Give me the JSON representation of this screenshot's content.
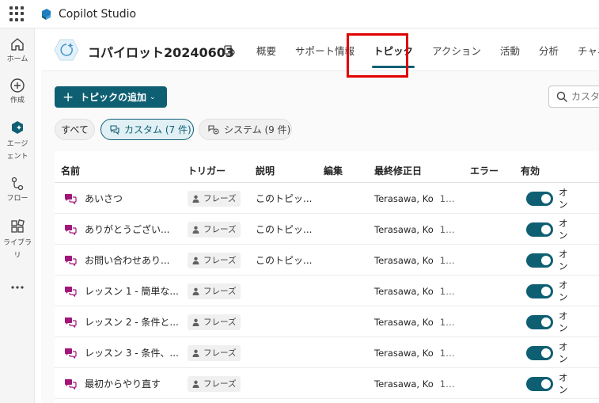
{
  "app": {
    "title": "Copilot Studio"
  },
  "colors": {
    "accent": "#0f5f73",
    "topic_icon": "#a1167a",
    "highlight": "#e00000"
  },
  "rail": {
    "items": [
      {
        "label": "ホーム",
        "icon": "home-icon"
      },
      {
        "label": "作成",
        "icon": "create-icon"
      },
      {
        "label": "エージェント",
        "icon": "agent-icon"
      },
      {
        "label": "フロー",
        "icon": "flow-icon"
      },
      {
        "label": "ライブラリ",
        "icon": "library-icon"
      },
      {
        "label": "",
        "icon": "more-icon"
      }
    ]
  },
  "agent": {
    "name": "コパイロット20240603"
  },
  "tabs": [
    {
      "label": "概要"
    },
    {
      "label": "サポート情報"
    },
    {
      "label": "トピック",
      "active": true
    },
    {
      "label": "アクション"
    },
    {
      "label": "活動"
    },
    {
      "label": "分析"
    },
    {
      "label": "チャネル"
    }
  ],
  "toolbar": {
    "add_label": "トピックの追加",
    "search_placeholder": "カスタ"
  },
  "filters": {
    "all": "すべて",
    "custom": "カスタム (7 件)",
    "system": "システム (9 件)"
  },
  "table": {
    "columns": {
      "name": "名前",
      "trigger": "トリガー",
      "description": "説明",
      "editing": "編集",
      "modified": "最終修正日",
      "errors": "エラー",
      "enabled": "有効"
    },
    "rows": [
      {
        "name": "あいさつ",
        "trigger": "フレーズ",
        "description": "このトピッ...",
        "modified_by": "Terasawa, Ko",
        "modified_date": "10 ...",
        "enabled": "オン"
      },
      {
        "name": "ありがとうござい...",
        "trigger": "フレーズ",
        "description": "このトピッ...",
        "modified_by": "Terasawa, Ko",
        "modified_date": "10 ...",
        "enabled": "オン"
      },
      {
        "name": "お問い合わせあり...",
        "trigger": "フレーズ",
        "description": "このトピッ...",
        "modified_by": "Terasawa, Ko",
        "modified_date": "10 ...",
        "enabled": "オン"
      },
      {
        "name": "レッスン 1 - 簡単な...",
        "trigger": "フレーズ",
        "description": "",
        "modified_by": "Terasawa, Ko",
        "modified_date": "10 ...",
        "enabled": "オン"
      },
      {
        "name": "レッスン 2 - 条件と...",
        "trigger": "フレーズ",
        "description": "",
        "modified_by": "Terasawa, Ko",
        "modified_date": "10 ...",
        "enabled": "オン"
      },
      {
        "name": "レッスン 3 - 条件、...",
        "trigger": "フレーズ",
        "description": "",
        "modified_by": "Terasawa, Ko",
        "modified_date": "10 ...",
        "enabled": "オン"
      },
      {
        "name": "最初からやり直す",
        "trigger": "フレーズ",
        "description": "",
        "modified_by": "Terasawa, Ko",
        "modified_date": "10 ...",
        "enabled": "オン"
      }
    ]
  }
}
